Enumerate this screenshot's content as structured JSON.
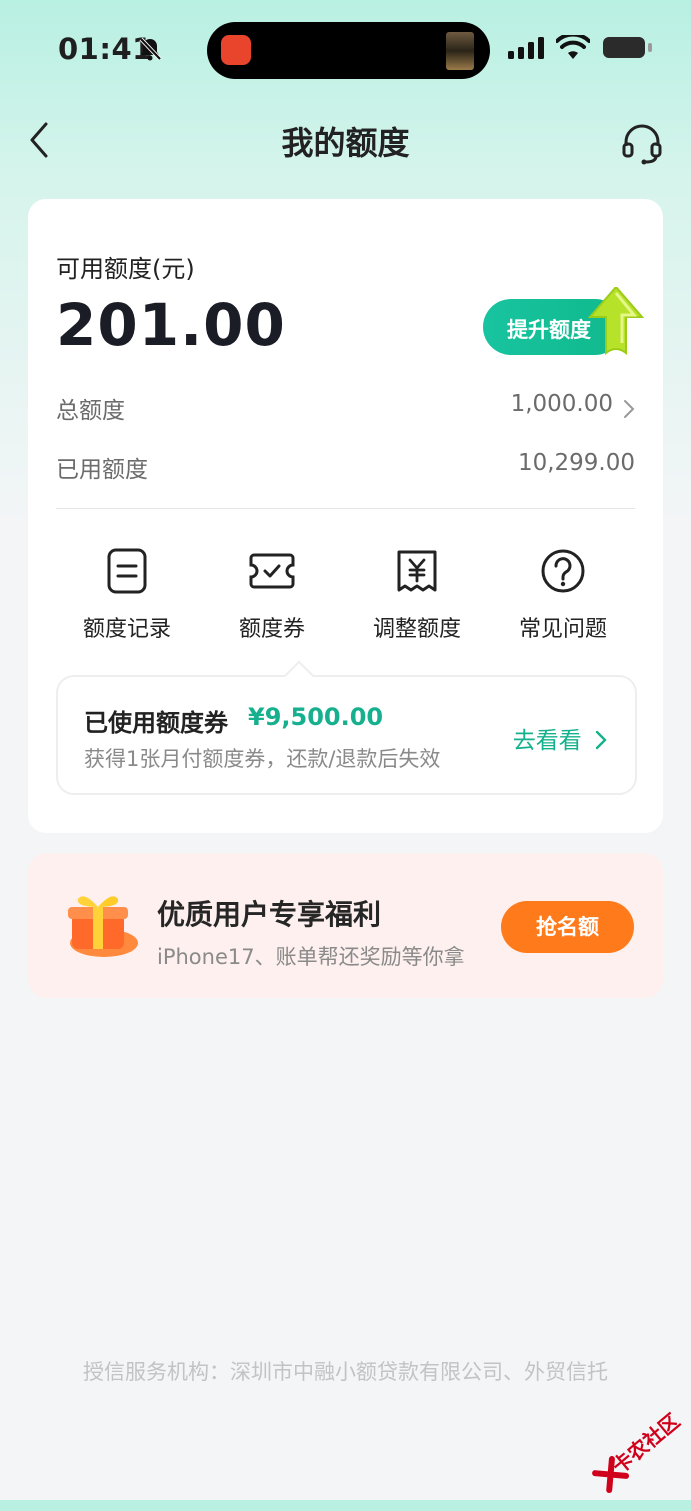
{
  "status_bar": {
    "time": "01:41"
  },
  "header": {
    "title": "我的额度"
  },
  "credit": {
    "available_label": "可用额度(元)",
    "available_amount": "201.00",
    "raise_button": "提升额度",
    "total_label": "总额度",
    "total_value": "1,000.00",
    "used_label": "已用额度",
    "used_value": "10,299.00"
  },
  "shortcuts": [
    {
      "label": "额度记录",
      "icon": "document-icon"
    },
    {
      "label": "额度券",
      "icon": "ticket-check-icon"
    },
    {
      "label": "调整额度",
      "icon": "yuan-receipt-icon"
    },
    {
      "label": "常见问题",
      "icon": "question-circle-icon"
    }
  ],
  "coupon": {
    "title": "已使用额度券",
    "amount": "¥9,500.00",
    "subtitle": "获得1张月付额度券，还款/退款后失效",
    "link": "去看看"
  },
  "promo": {
    "title": "优质用户专享福利",
    "subtitle": "iPhone17、账单帮还奖励等你拿",
    "button": "抢名额"
  },
  "footer": {
    "text": "授信服务机构：深圳市中融小额贷款有限公司、外贸信托"
  },
  "watermark": {
    "text": "卡农社区"
  },
  "colors": {
    "accent": "#16b08e",
    "promo_button": "#ff7a1a"
  }
}
